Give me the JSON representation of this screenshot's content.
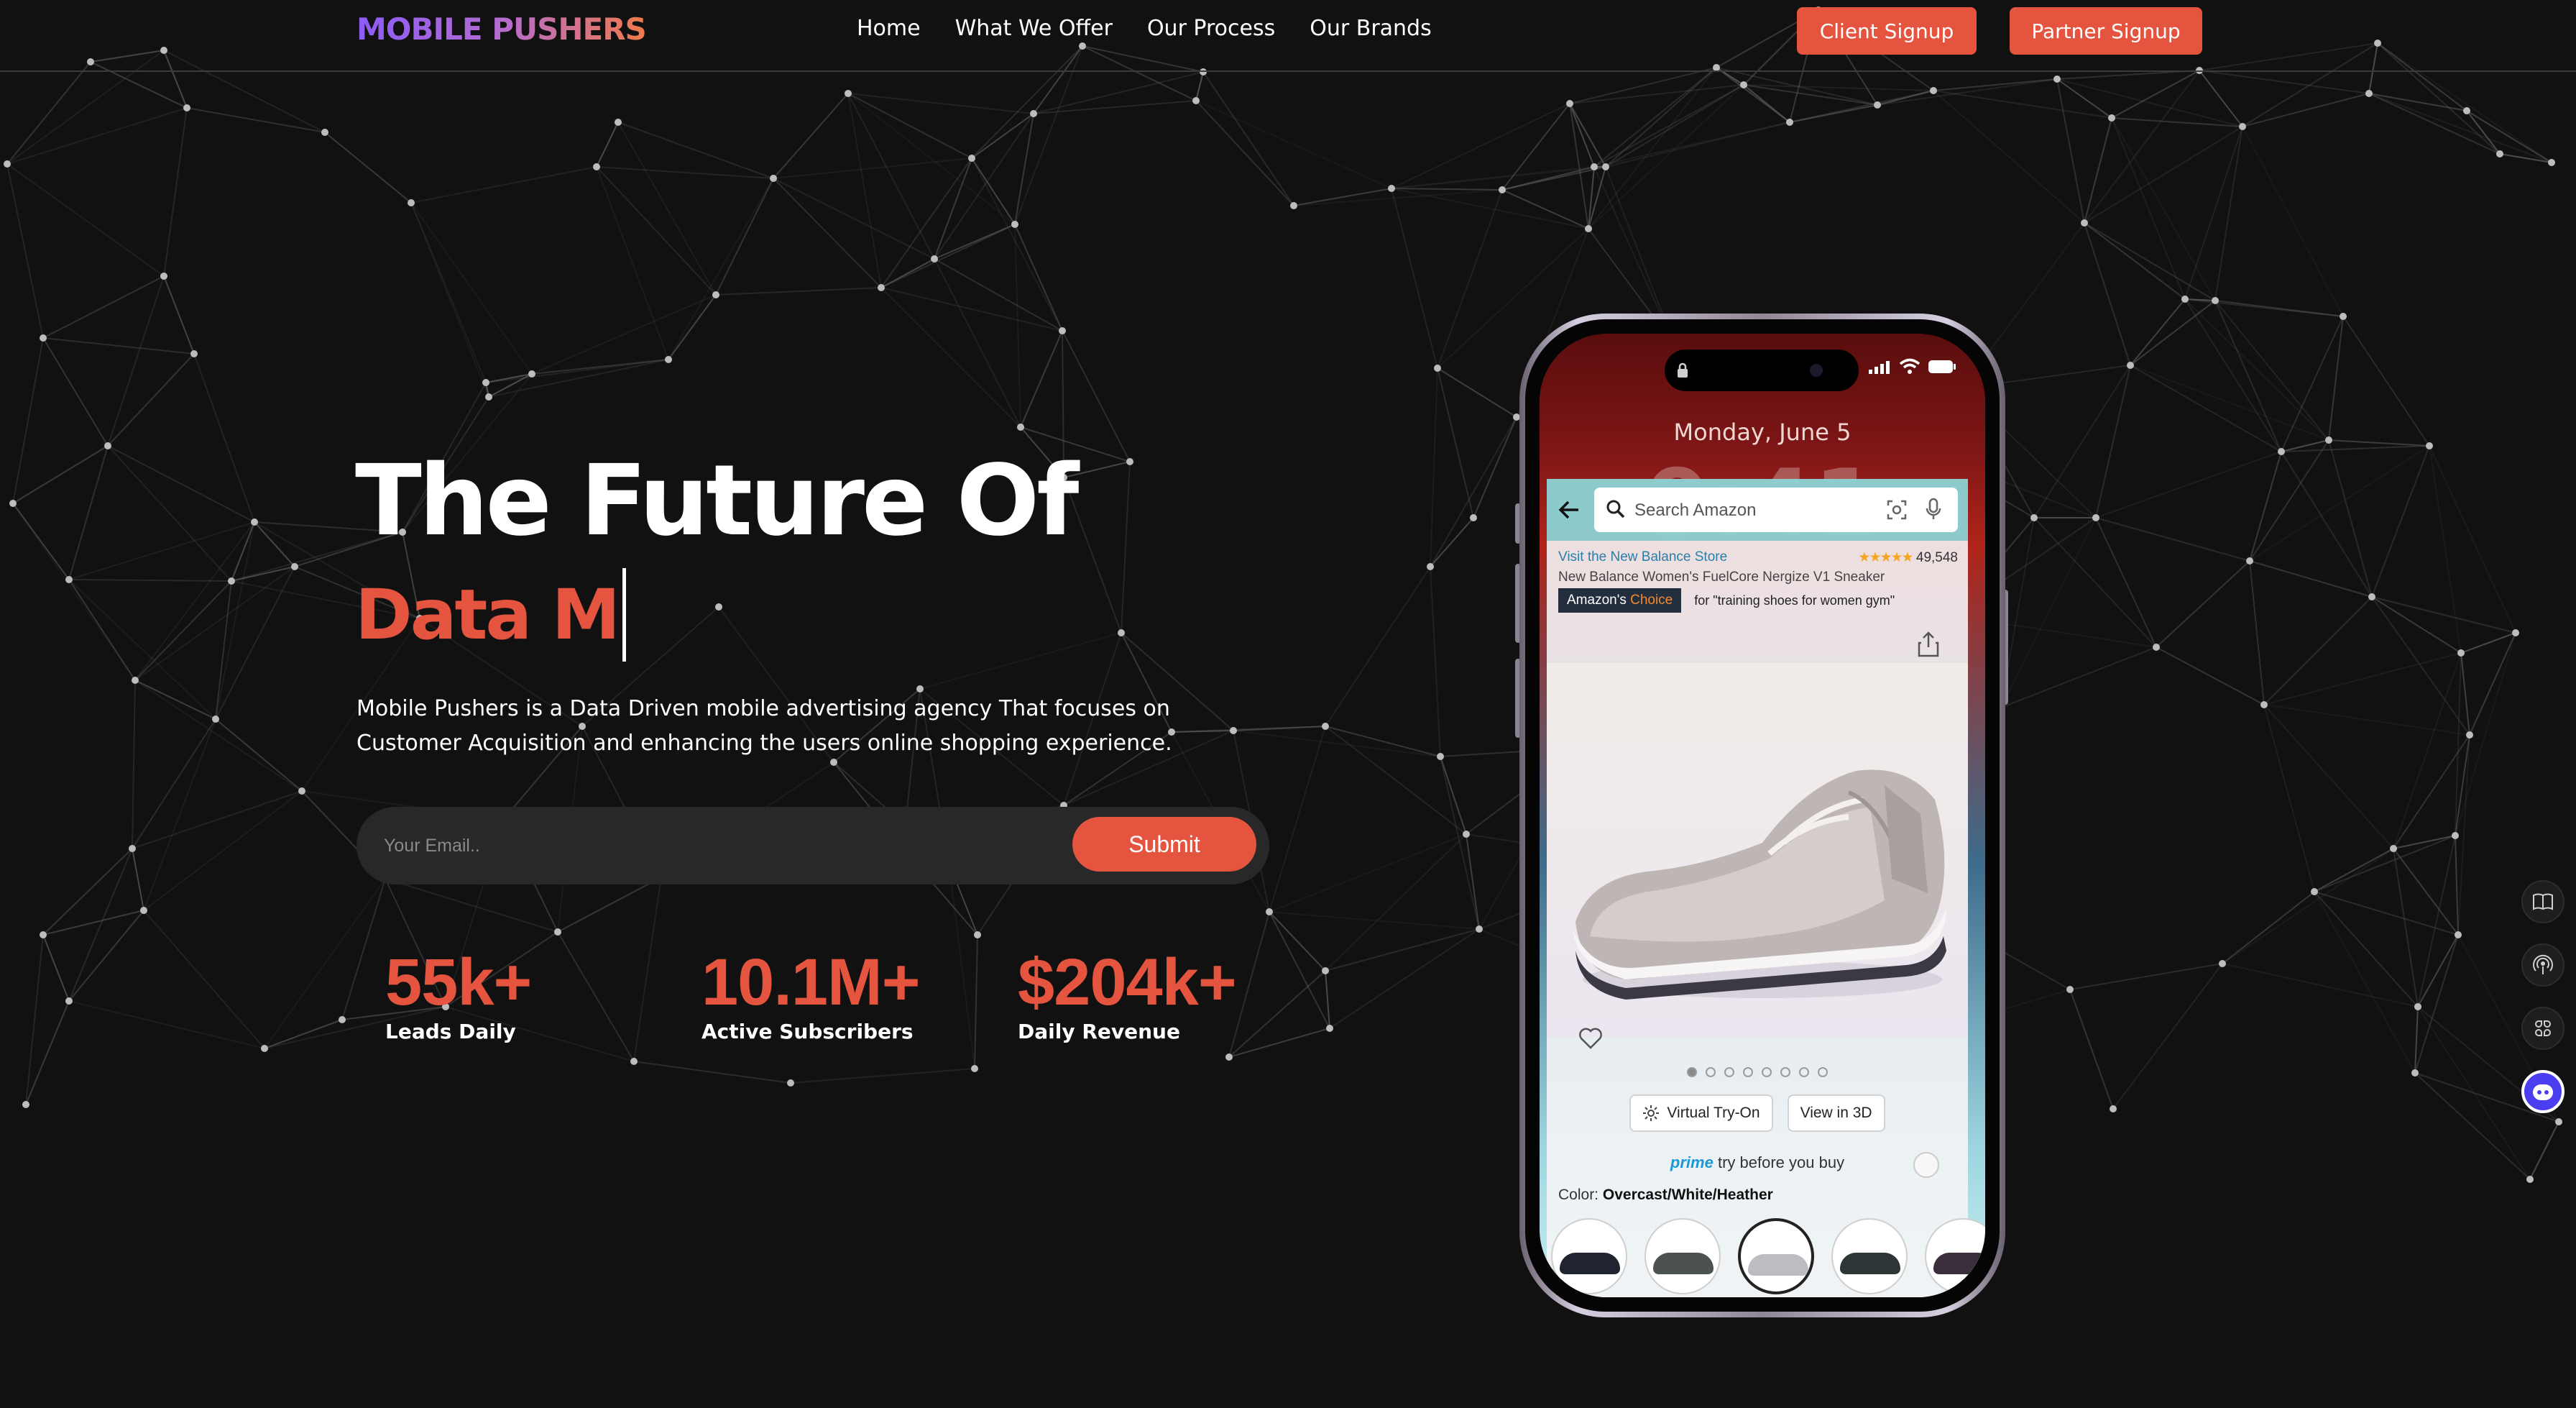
{
  "nav": {
    "logo": "MOBILE PUSHERS",
    "links": [
      "Home",
      "What We Offer",
      "Our Process",
      "Our Brands"
    ],
    "client_signup": "Client Signup",
    "partner_signup": "Partner Signup"
  },
  "hero": {
    "title": "The Future Of",
    "typed": "Data M",
    "description": "Mobile Pushers is a Data Driven mobile advertising agency That focuses on Customer Acquisition and enhancing the users online shopping experience.",
    "email_placeholder": "Your Email..",
    "submit_label": "Submit"
  },
  "stats": [
    {
      "value": "55k+",
      "label": "Leads Daily"
    },
    {
      "value": "10.1M+",
      "label": "Active Subscribers"
    },
    {
      "value": "$204k+",
      "label": "Daily Revenue"
    }
  ],
  "phone": {
    "date": "Monday, June 5",
    "time": "9:41",
    "search_placeholder": "Search Amazon",
    "store_link": "Visit the New Balance Store",
    "rating_stars": "★★★★★",
    "rating_count": "49,548",
    "product_title": "New Balance Women's FuelCore Nergize V1 Sneaker",
    "choice_prefix": "Amazon's",
    "choice_word": "Choice",
    "choice_for": "for \"training shoes for women gym\"",
    "virtual_tryon": "Virtual Try-On",
    "view_3d": "View in 3D",
    "prime_word": "prime",
    "prime_text": "try before you buy",
    "color_label": "Color:",
    "color_value": "Overcast/White/Heather"
  },
  "colors": {
    "background": "#111111",
    "accent": "#e4543f",
    "logo_gradient_start": "#8b5cf6",
    "logo_gradient_end": "#f07a4a",
    "chat_widget": "#4b3df0"
  },
  "icons": [
    "book-icon",
    "podcast-icon",
    "grid-icon",
    "chat-bot-icon"
  ]
}
